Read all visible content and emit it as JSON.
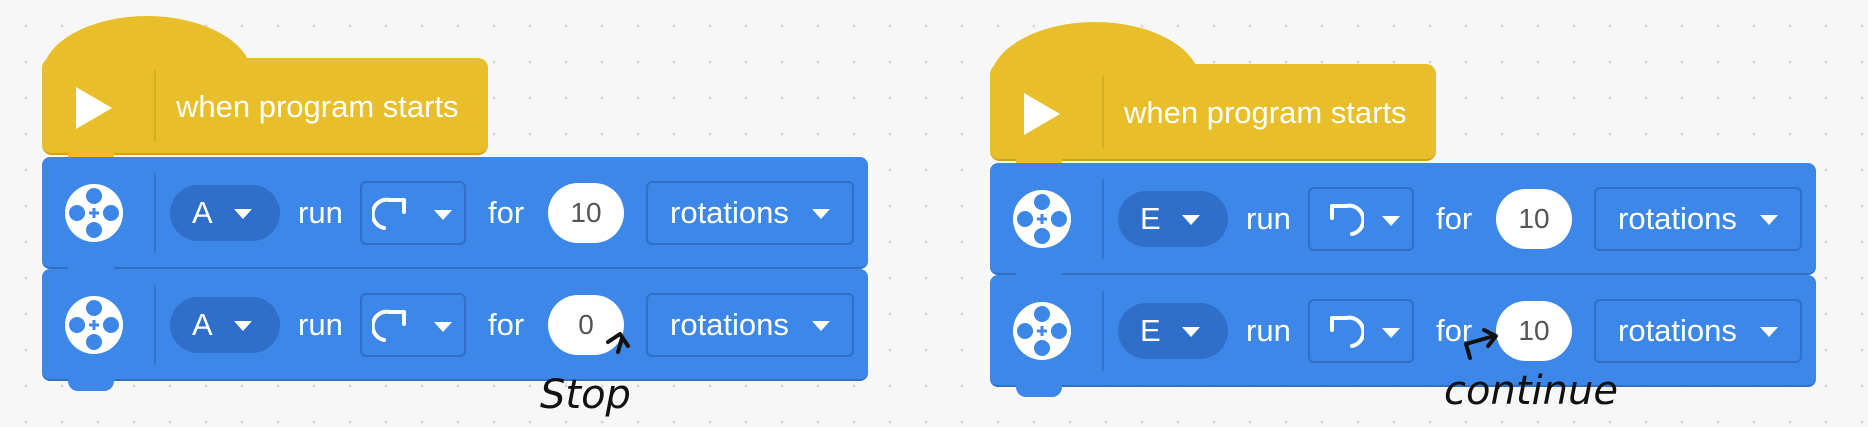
{
  "stacks": [
    {
      "hat_label": "when program starts",
      "blocks": [
        {
          "port": "A",
          "run": "run",
          "direction": "clockwise",
          "for": "for",
          "value": "10",
          "unit": "rotations"
        },
        {
          "port": "A",
          "run": "run",
          "direction": "clockwise",
          "for": "for",
          "value": "0",
          "unit": "rotations"
        }
      ],
      "annotation": "Stop"
    },
    {
      "hat_label": "when program starts",
      "blocks": [
        {
          "port": "E",
          "run": "run",
          "direction": "counterclockwise",
          "for": "for",
          "value": "10",
          "unit": "rotations"
        },
        {
          "port": "E",
          "run": "run",
          "direction": "counterclockwise",
          "for": "for",
          "value": "10",
          "unit": "rotations"
        }
      ],
      "annotation": "continue"
    }
  ],
  "icons": {
    "play": "play-icon",
    "motor": "motor-icon",
    "clockwise": "rotate-clockwise-icon",
    "counterclockwise": "rotate-counterclockwise-icon",
    "dropdown": "chevron-down-icon"
  },
  "colors": {
    "event_block": "#e8bf2a",
    "motor_block": "#3d87e8",
    "port_pill": "#2f6fca",
    "annotation_ink": "#111111"
  }
}
